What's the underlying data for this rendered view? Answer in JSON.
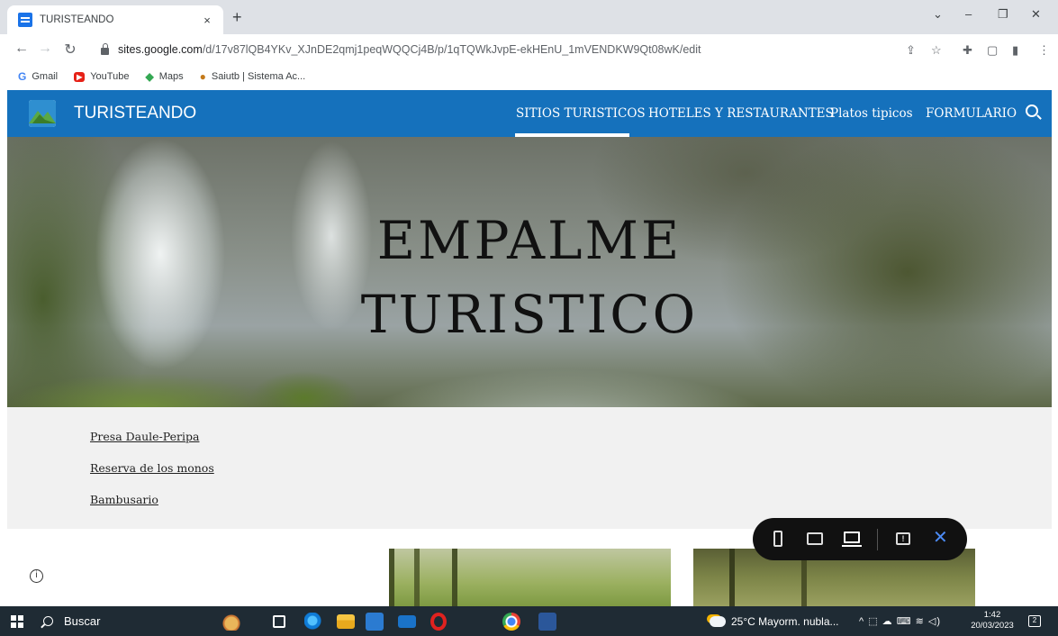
{
  "browser": {
    "tab_title": "TURISTEANDO",
    "tab_close": "×",
    "new_tab": "+",
    "window_controls": [
      "⌄",
      "–",
      "❐",
      "✕"
    ],
    "url_host": "sites.google.com",
    "url_path": "/d/17v87lQB4YKv_XJnDE2qmj1peqWQQCj4B/p/1qTQWkJvpE-ekHEnU_1mVENDKW9Qt08wK/edit",
    "bookmarks": [
      {
        "label": "Gmail",
        "icon": "G"
      },
      {
        "label": "YouTube",
        "icon": "▶"
      },
      {
        "label": "Maps",
        "icon": "◆"
      },
      {
        "label": "Saiutb | Sistema Ac...",
        "icon": "●"
      }
    ]
  },
  "site": {
    "title": "TURISTEANDO",
    "nav": [
      {
        "label": "SITIOS TURISTICOS",
        "active": true
      },
      {
        "label": "HOTELES Y RESTAURANTES",
        "active": false
      },
      {
        "label": "Platos tipicos",
        "active": false
      },
      {
        "label": "FORMULARIO",
        "active": false
      }
    ],
    "header_color": "#1571bc",
    "hero_title_line1": "EMPALME",
    "hero_title_line2": "TURISTICO",
    "links": [
      "Presa Daule-Peripa",
      "Reserva de los monos",
      "Bambusario"
    ]
  },
  "preview_bar": {
    "feedback_mark": "!",
    "close": "✕"
  },
  "taskbar": {
    "search_label": "Buscar",
    "weather": "25°C  Mayorm. nubla...",
    "time": "1:42",
    "date": "20/03/2023",
    "notifications": "2",
    "tray_icons": "^  ⬚  ☁  ⌨  ≋  ◁)"
  }
}
